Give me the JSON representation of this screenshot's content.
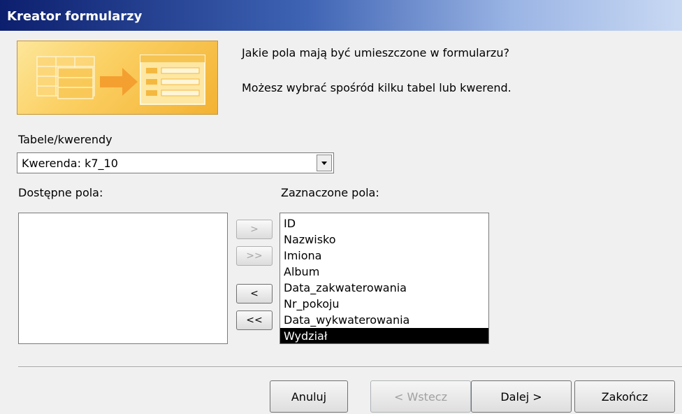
{
  "window": {
    "title": "Kreator formularzy"
  },
  "header": {
    "question": "Jakie pola mają być umieszczone w formularzu?",
    "hint": "Możesz wybrać spośród kilku tabel lub kwerend."
  },
  "source": {
    "label": "Tabele/kwerendy",
    "selected": "Kwerenda: k7_10"
  },
  "available": {
    "label": "Dostępne pola",
    "items": []
  },
  "selected_fields": {
    "label": "Zaznaczone pola",
    "items": [
      "ID",
      "Nazwisko",
      "Imiona",
      "Album",
      "Data_zakwaterowania",
      "Nr_pokoju",
      "Data_wykwaterowania",
      "Wydział"
    ],
    "highlighted": "Wydział"
  },
  "move_buttons": {
    "add_one": ">",
    "add_all": ">>",
    "remove_one": "<",
    "remove_all": "<<"
  },
  "footer": {
    "cancel": "Anuluj",
    "back": "< Wstecz",
    "next": "Dalej >",
    "finish": "Zakończ"
  },
  "colors": {
    "titlebar_start": "#0c1f6e",
    "titlebar_end": "#c9d9f3",
    "illustration": "#fbd063",
    "selection": "#000000"
  }
}
